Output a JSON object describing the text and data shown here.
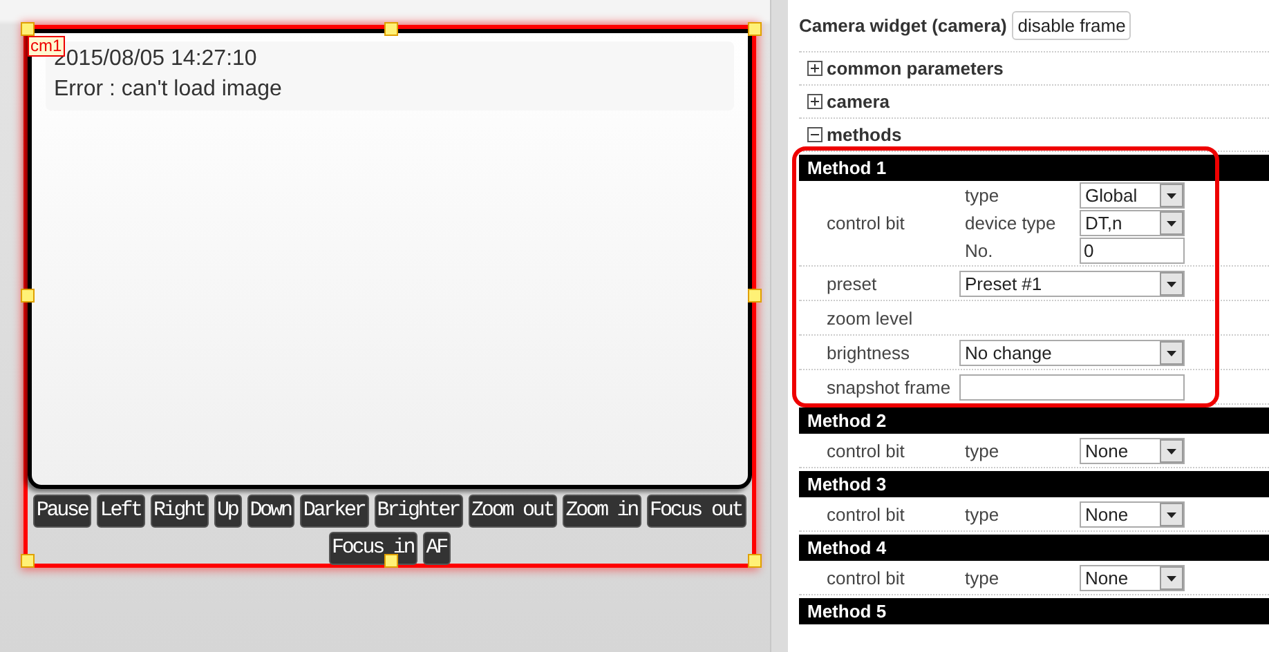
{
  "widget": {
    "label": "cm1",
    "selected": true,
    "timestamp": "2015/08/05 14:27:10",
    "message": "Error : can't load image",
    "buttons": [
      "Pause",
      "Left",
      "Right",
      "Up",
      "Down",
      "Darker",
      "Brighter",
      "Zoom out",
      "Zoom in",
      "Focus out",
      "Focus in",
      "AF"
    ]
  },
  "properties": {
    "title": "Camera widget (camera)",
    "frame_button": "disable frame",
    "sections": [
      {
        "label": "common parameters",
        "expanded": false
      },
      {
        "label": "camera",
        "expanded": false
      },
      {
        "label": "methods",
        "expanded": true
      }
    ],
    "methods": [
      {
        "title": "Method 1",
        "highlighted": true,
        "rows": [
          {
            "kind": "group",
            "label": "control bit",
            "fields": [
              {
                "label": "type",
                "kind": "select",
                "value": "Global"
              },
              {
                "label": "device type",
                "kind": "select",
                "value": "DT,n"
              },
              {
                "label": "No.",
                "kind": "input",
                "value": "0"
              }
            ]
          },
          {
            "kind": "select",
            "label": "preset",
            "value": "Preset #1"
          },
          {
            "kind": "text",
            "label": "zoom level"
          },
          {
            "kind": "select",
            "label": "brightness",
            "value": "No change"
          },
          {
            "kind": "input",
            "label": "snapshot frame",
            "value": ""
          }
        ]
      },
      {
        "title": "Method 2",
        "highlighted": false,
        "rows": [
          {
            "kind": "group",
            "label": "control bit",
            "fields": [
              {
                "label": "type",
                "kind": "select",
                "value": "None"
              }
            ]
          }
        ]
      },
      {
        "title": "Method 3",
        "highlighted": false,
        "rows": [
          {
            "kind": "group",
            "label": "control bit",
            "fields": [
              {
                "label": "type",
                "kind": "select",
                "value": "None"
              }
            ]
          }
        ]
      },
      {
        "title": "Method 4",
        "highlighted": false,
        "rows": [
          {
            "kind": "group",
            "label": "control bit",
            "fields": [
              {
                "label": "type",
                "kind": "select",
                "value": "None"
              }
            ]
          }
        ]
      },
      {
        "title": "Method 5",
        "highlighted": false
      }
    ]
  }
}
